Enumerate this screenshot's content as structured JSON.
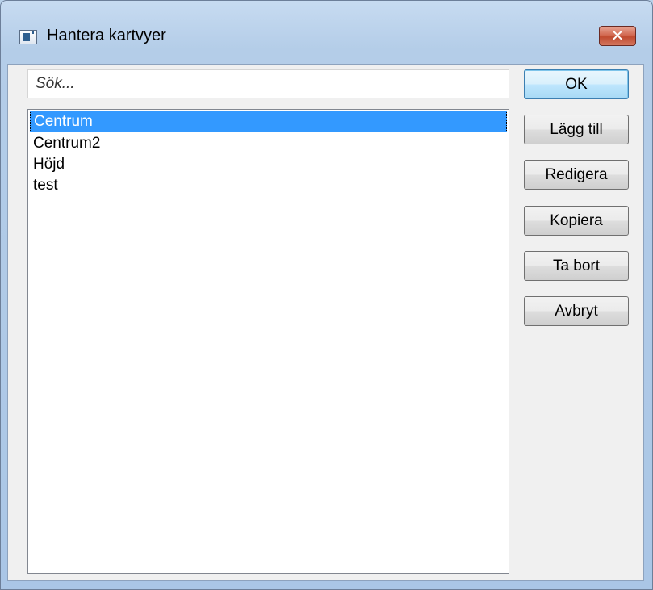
{
  "window": {
    "title": "Hantera kartvyer",
    "close_label": "✕",
    "app_icon": "window-icon"
  },
  "search": {
    "placeholder": "Sök..."
  },
  "list": {
    "items": [
      {
        "label": "Centrum",
        "selected": true
      },
      {
        "label": "Centrum2",
        "selected": false
      },
      {
        "label": "Höjd",
        "selected": false
      },
      {
        "label": "test",
        "selected": false
      }
    ]
  },
  "buttons": {
    "ok": "OK",
    "add": "Lägg till",
    "edit": "Redigera",
    "copy": "Kopiera",
    "delete": "Ta bort",
    "cancel": "Avbryt"
  },
  "colors": {
    "selection": "#3399ff",
    "close_button": "#c9563b"
  }
}
